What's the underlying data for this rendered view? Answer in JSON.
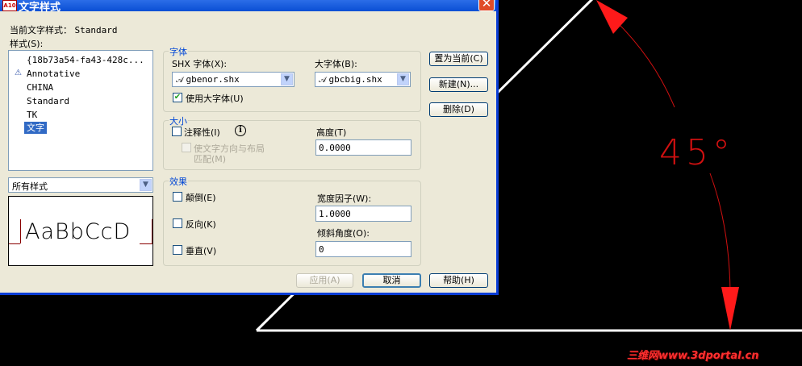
{
  "window": {
    "title": "文字样式",
    "app_icon": "A10",
    "close_label": "✕"
  },
  "current_style": {
    "label": "当前文字样式：",
    "value": "Standard"
  },
  "styles_label": "样式(S):",
  "styles": [
    {
      "label": "{18b73a54-fa43-428c...",
      "icon": ""
    },
    {
      "label": "Annotative",
      "icon": "annotative-icon"
    },
    {
      "label": "CHINA",
      "icon": ""
    },
    {
      "label": "Standard",
      "icon": ""
    },
    {
      "label": "TK",
      "icon": ""
    },
    {
      "label": "文字",
      "icon": "",
      "selected": true
    }
  ],
  "filter": {
    "value": "所有样式"
  },
  "preview_text": "AaBbCcD",
  "font_group": {
    "title": "字体",
    "shx_label": "SHX 字体(X):",
    "shx_value": "gbenor.shx",
    "bigfont_label": "大字体(B):",
    "bigfont_value": "gbcbig.shx",
    "use_bigfont_label": "使用大字体(U)",
    "use_bigfont_checked": true
  },
  "size_group": {
    "title": "大小",
    "annotative_label": "注释性(I)",
    "match_line1": "使文字方向与布局",
    "match_line2": "匹配(M)",
    "height_label": "高度(T)",
    "height_value": "0.0000"
  },
  "effects_group": {
    "title": "效果",
    "upside_down_label": "颠倒(E)",
    "backwards_label": "反向(K)",
    "vertical_label": "垂直(V)",
    "width_factor_label": "宽度因子(W):",
    "width_factor_value": "1.0000",
    "oblique_label": "倾斜角度(O):",
    "oblique_value": "0"
  },
  "buttons": {
    "set_current": "置为当前(C)",
    "new": "新建(N)...",
    "delete": "删除(D)",
    "apply": "应用(A)",
    "cancel": "取消",
    "help": "帮助(H)"
  },
  "drawing": {
    "angle_label": "45°",
    "watermark": "三维网www.3dportal.cn",
    "colors": {
      "line": "#ffffff",
      "dim": "#d01010",
      "background": "#000000"
    }
  }
}
